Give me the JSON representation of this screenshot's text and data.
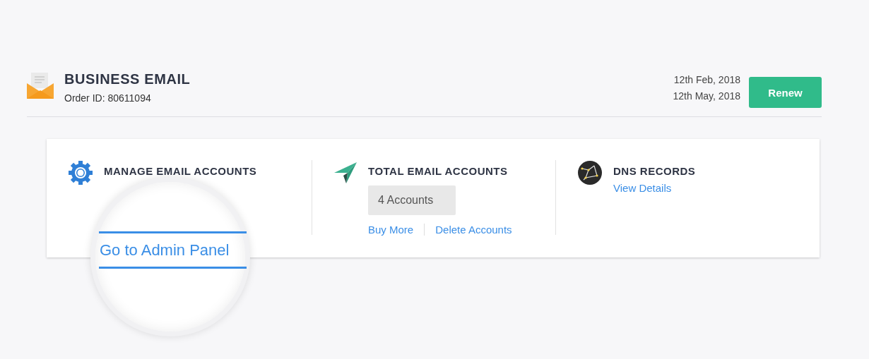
{
  "order": {
    "title": "BUSINESS EMAIL",
    "order_id": "Order ID: 80611094",
    "dates": [
      "12th Feb, 2018",
      "12th May, 2018"
    ],
    "renew_button": "Renew"
  },
  "panels": [
    {
      "kind": "manage",
      "title": "MANAGE EMAIL ACCOUNTS"
    },
    {
      "kind": "total",
      "title": "TOTAL EMAIL ACCOUNTS",
      "count": "4 Accounts",
      "links": [
        "Buy More",
        "Delete Accounts"
      ]
    },
    {
      "kind": "dns",
      "title": "DNS RECORDS",
      "links": [
        "View Details"
      ]
    }
  ],
  "magnifier": {
    "link": "Go to Admin Panel"
  }
}
